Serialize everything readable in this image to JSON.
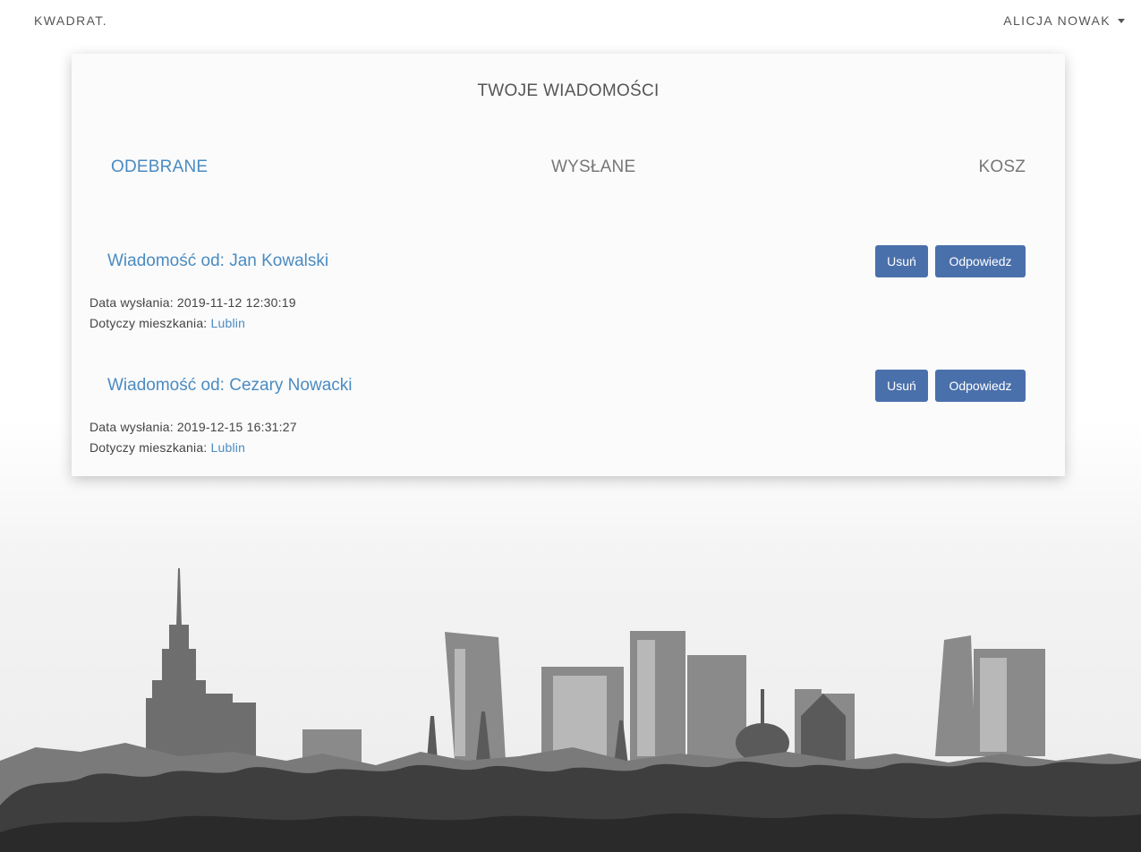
{
  "navbar": {
    "brand": "KWADRAT.",
    "user_name": "ALICJA NOWAK"
  },
  "card": {
    "title": "TWOJE WIADOMOŚCI",
    "tabs": [
      {
        "label": "ODEBRANE",
        "active": true
      },
      {
        "label": "WYSŁANE",
        "active": false
      },
      {
        "label": "KOSZ",
        "active": false
      }
    ]
  },
  "messages": [
    {
      "title": "Wiadomość od: Jan Kowalski",
      "date_label": "Data wysłania: 2019-11-12 12:30:19",
      "flat_label": "Dotyczy mieszkania: ",
      "flat_link": "Lublin",
      "delete_label": "Usuń",
      "reply_label": "Odpowiedz"
    },
    {
      "title": "Wiadomość od: Cezary Nowacki",
      "date_label": "Data wysłania: 2019-12-15 16:31:27",
      "flat_label": "Dotyczy mieszkania: ",
      "flat_link": "Lublin",
      "delete_label": "Usuń",
      "reply_label": "Odpowiedz"
    }
  ],
  "colors": {
    "accent": "#4a8bc2",
    "button": "#4a70ab",
    "card_background": "#fbfbfb"
  },
  "background_image": "black-and-white-city-skyline"
}
